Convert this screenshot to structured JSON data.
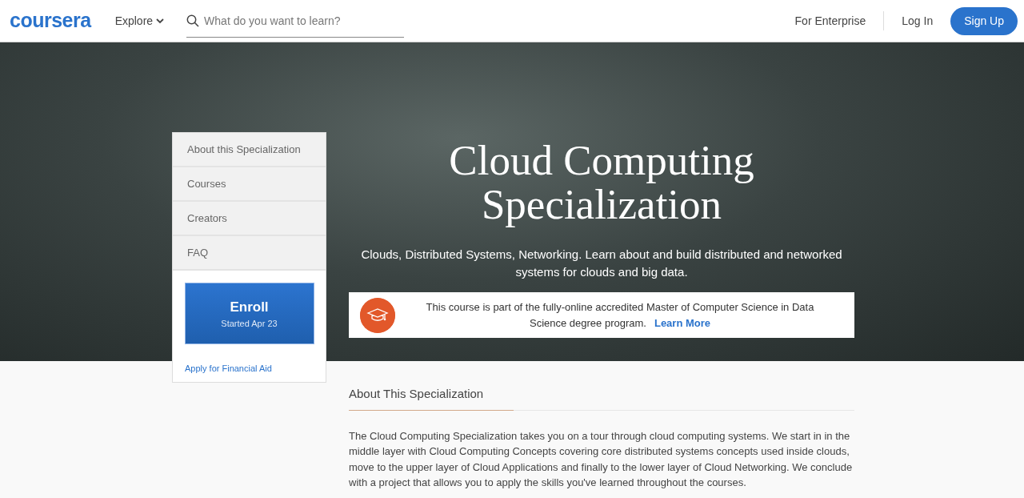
{
  "header": {
    "logo": "coursera",
    "explore": "Explore",
    "search": {
      "placeholder": "What do you want to learn?"
    },
    "enterprise": "For Enterprise",
    "login": "Log In",
    "signup": "Sign Up"
  },
  "sidebar": {
    "items": [
      "About this Specialization",
      "Courses",
      "Creators",
      "FAQ"
    ],
    "enroll": {
      "label": "Enroll",
      "sub": "Started Apr 23"
    },
    "financial_aid": "Apply for Financial Aid"
  },
  "hero": {
    "title": "Cloud Computing Specialization",
    "subtitle": "Clouds, Distributed Systems, Networking. Learn about and build distributed and networked systems for clouds and big data.",
    "banner": {
      "text": "This course is part of the fully-online accredited Master of Computer Science in Data Science degree program.",
      "link": "Learn More"
    }
  },
  "about": {
    "heading": "About This Specialization",
    "body": "The Cloud Computing Specialization takes you on a tour through cloud computing systems. We start in in the middle layer with Cloud Computing Concepts covering core distributed systems concepts used inside clouds, move to the upper layer of Cloud Applications and finally to the lower layer of Cloud Networking. We conclude with a project that allows you to apply the skills you've learned throughout the courses."
  }
}
